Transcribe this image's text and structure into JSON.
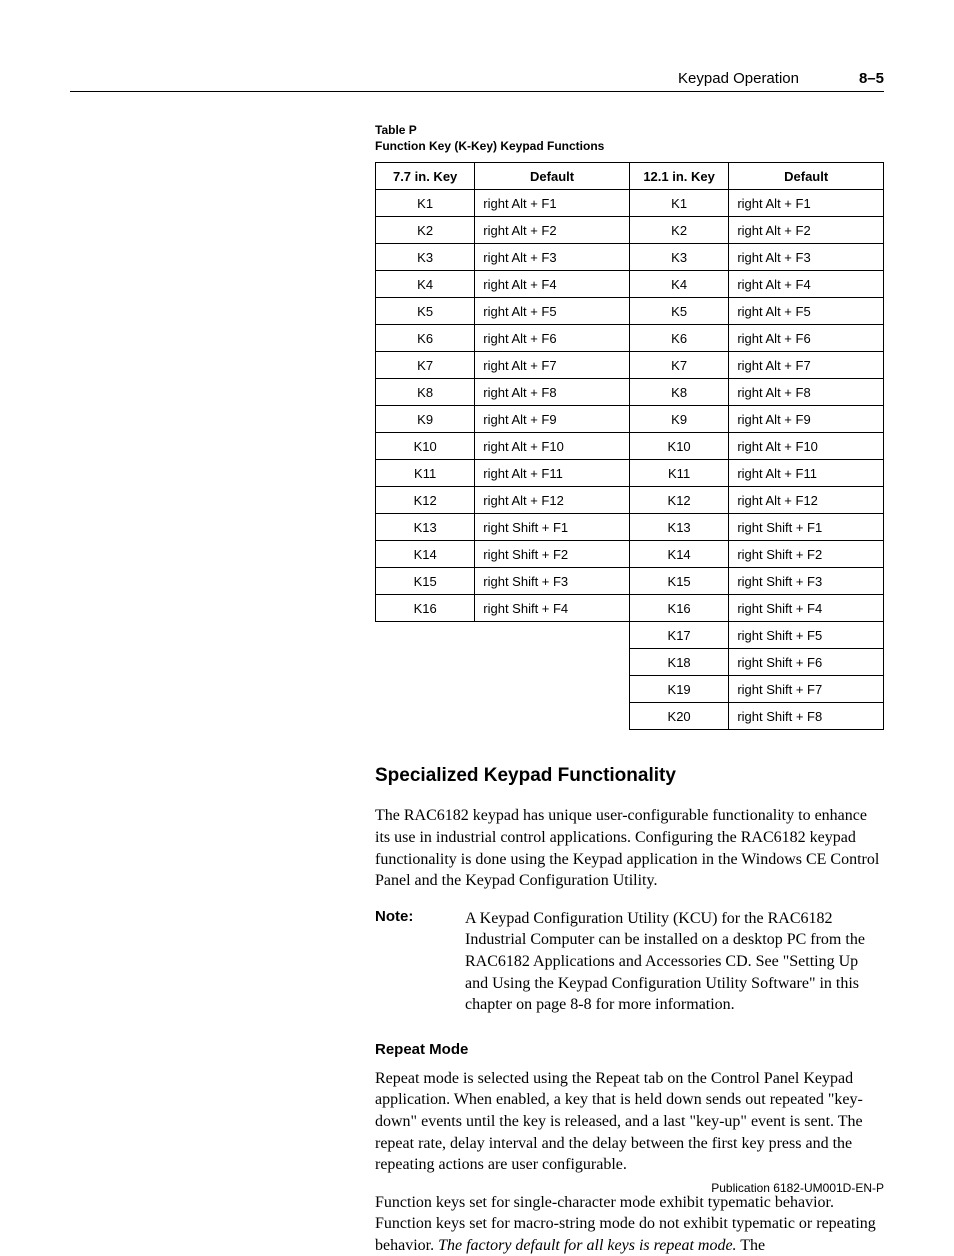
{
  "header": {
    "title": "Keypad Operation",
    "pagenum": "8–5"
  },
  "table": {
    "caption_line1": "Table P",
    "caption_line2": "Function Key (K-Key) Keypad Functions",
    "headers": [
      "7.7 in. Key",
      "Default",
      "12.1 in. Key",
      "Default"
    ],
    "rows": [
      {
        "k1": "K1",
        "d1": "right Alt + F1",
        "k2": "K1",
        "d2": "right Alt + F1"
      },
      {
        "k1": "K2",
        "d1": "right Alt + F2",
        "k2": "K2",
        "d2": "right Alt + F2"
      },
      {
        "k1": "K3",
        "d1": "right Alt + F3",
        "k2": "K3",
        "d2": "right Alt + F3"
      },
      {
        "k1": "K4",
        "d1": "right Alt + F4",
        "k2": "K4",
        "d2": "right Alt + F4"
      },
      {
        "k1": "K5",
        "d1": "right Alt + F5",
        "k2": "K5",
        "d2": "right Alt + F5"
      },
      {
        "k1": "K6",
        "d1": "right Alt + F6",
        "k2": "K6",
        "d2": "right Alt + F6"
      },
      {
        "k1": "K7",
        "d1": "right Alt + F7",
        "k2": "K7",
        "d2": "right Alt + F7"
      },
      {
        "k1": "K8",
        "d1": "right Alt + F8",
        "k2": "K8",
        "d2": "right Alt + F8"
      },
      {
        "k1": "K9",
        "d1": "right Alt + F9",
        "k2": "K9",
        "d2": "right Alt + F9"
      },
      {
        "k1": "K10",
        "d1": "right Alt + F10",
        "k2": "K10",
        "d2": "right Alt + F10"
      },
      {
        "k1": "K11",
        "d1": "right Alt + F11",
        "k2": "K11",
        "d2": "right Alt + F11"
      },
      {
        "k1": "K12",
        "d1": "right Alt + F12",
        "k2": "K12",
        "d2": "right Alt + F12"
      },
      {
        "k1": "K13",
        "d1": "right Shift + F1",
        "k2": "K13",
        "d2": "right Shift + F1"
      },
      {
        "k1": "K14",
        "d1": "right Shift + F2",
        "k2": "K14",
        "d2": "right Shift + F2"
      },
      {
        "k1": "K15",
        "d1": "right Shift + F3",
        "k2": "K15",
        "d2": "right Shift + F3"
      },
      {
        "k1": "K16",
        "d1": "right Shift + F4",
        "k2": "K16",
        "d2": "right Shift + F4"
      },
      {
        "k1": "",
        "d1": "",
        "k2": "K17",
        "d2": "right Shift + F5"
      },
      {
        "k1": "",
        "d1": "",
        "k2": "K18",
        "d2": "right Shift + F6"
      },
      {
        "k1": "",
        "d1": "",
        "k2": "K19",
        "d2": "right Shift + F7"
      },
      {
        "k1": "",
        "d1": "",
        "k2": "K20",
        "d2": "right Shift + F8"
      }
    ]
  },
  "section": {
    "heading": "Specialized Keypad Functionality",
    "para1": "The RAC6182 keypad has unique user-configurable functionality to enhance its use in industrial control applications.  Configuring the RAC6182 keypad functionality is done using the Keypad application in the Windows CE Control Panel and the Keypad Configuration Utility.",
    "note_label": "Note:",
    "note_text": "A Keypad Configuration Utility (KCU) for the RAC6182 Industrial Computer can be installed on a desktop PC from the RAC6182 Applications and Accessories CD.  See \"Setting Up and Using the Keypad Configuration Utility Software\" in this chapter on page 8-8 for more information.",
    "subhead": "Repeat Mode",
    "para2": "Repeat mode is selected using the Repeat tab on the Control Panel Keypad application.  When enabled, a key that is held down sends out repeated \"key-down\" events until the key is released, and a last \"key-up\" event is sent.  The repeat rate, delay interval and the delay between the first key press and the repeating actions are user configurable.",
    "para3_pre": "Function keys set for single-character mode exhibit typematic behavior.  Function keys set for macro-string mode do not exhibit typematic or repeating behavior.  ",
    "para3_italic": "The factory default for all keys is repeat mode.",
    "para3_post": " The"
  },
  "footer": "Publication 6182-UM001D-EN-P"
}
